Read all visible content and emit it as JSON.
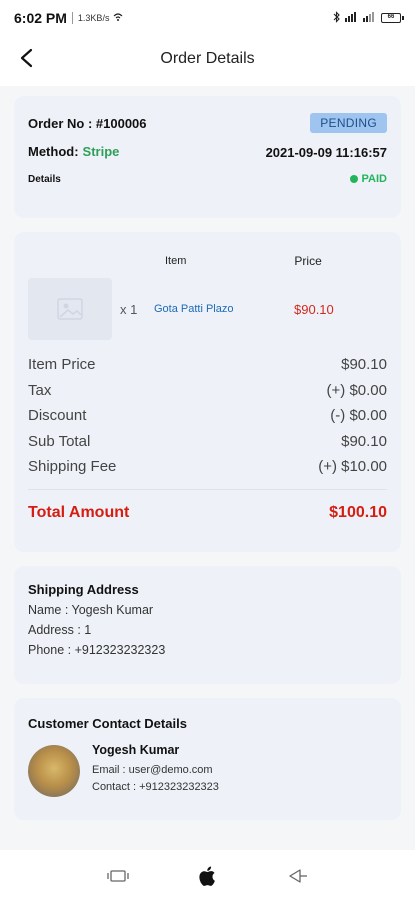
{
  "status_bar": {
    "time": "6:02 PM",
    "speed": "1.3KB/s",
    "battery": "66"
  },
  "app_bar": {
    "title": "Order Details"
  },
  "summary": {
    "order_no": "Order No : #100006",
    "status": "PENDING",
    "method_label": "Method:",
    "method_value": "Stripe",
    "date": "2021-09-09 11:16:57",
    "details_label": "Details",
    "payment_status": "PAID"
  },
  "items": {
    "header_item": "Item",
    "header_price": "Price",
    "rows": [
      {
        "qty": "x 1",
        "name": "Gota Patti Plazo",
        "price": "$90.10"
      }
    ]
  },
  "totals": {
    "rows": [
      {
        "label": "Item Price",
        "value": "$90.10"
      },
      {
        "label": "Tax",
        "value": "(+) $0.00"
      },
      {
        "label": "Discount",
        "value": "(-) $0.00"
      },
      {
        "label": "Sub Total",
        "value": "$90.10"
      },
      {
        "label": "Shipping Fee",
        "value": "(+) $10.00"
      }
    ],
    "total_label": "Total Amount",
    "total_value": "$100.10"
  },
  "shipping": {
    "title": "Shipping Address",
    "name": "Name : Yogesh Kumar",
    "address": "Address : 1",
    "phone": "Phone : +912323232323"
  },
  "contact": {
    "title": "Customer Contact Details",
    "name": "Yogesh Kumar",
    "email": "Email : user@demo.com",
    "phone": "Contact : +912323232323"
  },
  "colors": {
    "accent_red": "#d51d12",
    "paid_green": "#23b45b",
    "method_green": "#2f9e59",
    "link_blue": "#1c6ab6",
    "pending_badge": "#9fc4ef"
  },
  "icons": {
    "back": "back-arrow-icon",
    "recents": "recent-apps-icon",
    "home": "apple-logo-icon",
    "nav_back": "nav-back-icon"
  }
}
